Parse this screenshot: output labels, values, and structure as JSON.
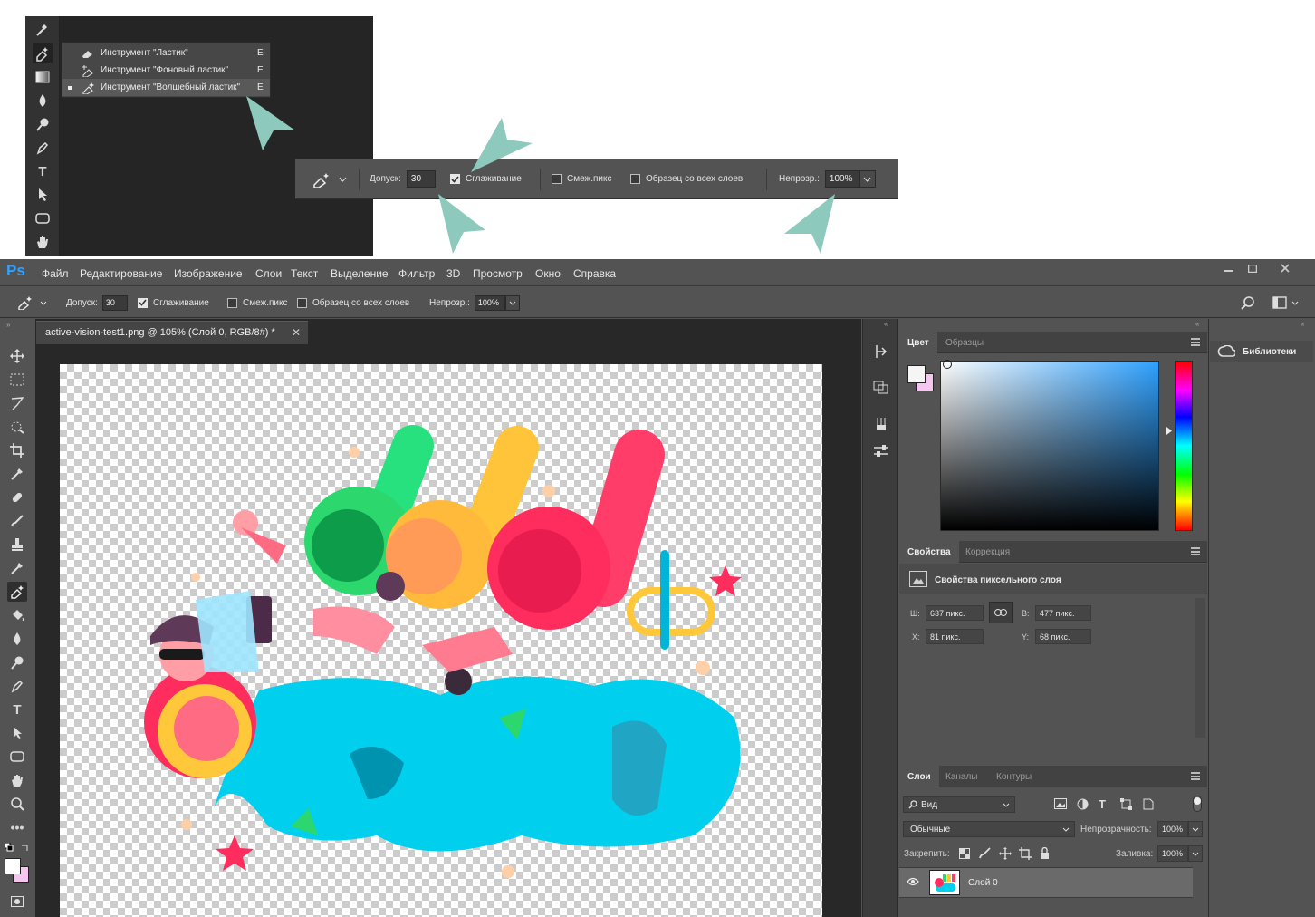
{
  "flyout": {
    "items": [
      {
        "label": "Инструмент \"Ластик\"",
        "shortcut": "E"
      },
      {
        "label": "Инструмент \"Фоновый ластик\"",
        "shortcut": "E"
      },
      {
        "label": "Инструмент \"Волшебный ластик\"",
        "shortcut": "E"
      }
    ]
  },
  "options": {
    "tolerance_label": "Допуск:",
    "tolerance_value": "30",
    "antialias_label": "Сглаживание",
    "contiguous_label": "Смеж.пикс",
    "sample_all_label": "Образец со всех слоев",
    "opacity_label": "Непрозр.:",
    "opacity_value": "100%"
  },
  "app": {
    "logo": "Ps",
    "menu": [
      "Файл",
      "Редактирование",
      "Изображение",
      "Слои",
      "Текст",
      "Выделение",
      "Фильтр",
      "3D",
      "Просмотр",
      "Окно",
      "Справка"
    ]
  },
  "document": {
    "tab_title": "active-vision-test1.png @ 105% (Слой 0, RGB/8#) *"
  },
  "color_panel": {
    "tabs": [
      "Цвет",
      "Образцы"
    ],
    "accent": "#2fa1ff"
  },
  "properties_panel": {
    "tabs": [
      "Свойства",
      "Коррекция"
    ],
    "header": "Свойства пиксельного слоя",
    "w_label": "Ш:",
    "w_value": "637 пикс.",
    "h_label": "В:",
    "h_value": "477 пикс.",
    "x_label": "X:",
    "x_value": "81 пикс.",
    "y_label": "Y:",
    "y_value": "68 пикс."
  },
  "layers_panel": {
    "tabs": [
      "Слои",
      "Каналы",
      "Контуры"
    ],
    "filter_value": "Вид",
    "blend_mode": "Обычные",
    "opacity_label": "Непрозрачность:",
    "opacity_value": "100%",
    "lock_label": "Закрепить:",
    "fill_label": "Заливка:",
    "fill_value": "100%",
    "layer_name": "Слой 0"
  },
  "libraries": {
    "label": "Библиотеки"
  }
}
